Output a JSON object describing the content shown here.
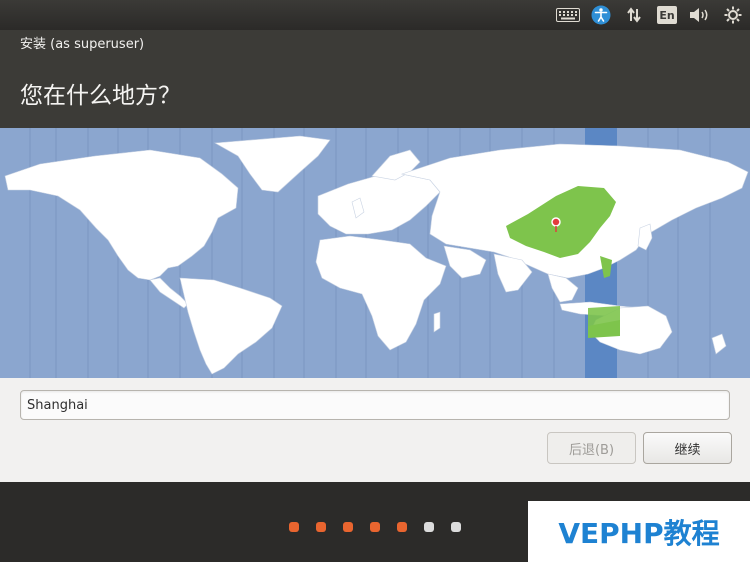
{
  "panel": {
    "language_badge": "En"
  },
  "window": {
    "title": "安装 (as superuser)",
    "heading": "您在什么地方？"
  },
  "location": {
    "value": "Shanghai"
  },
  "buttons": {
    "back_label": "后退(B)",
    "continue_label": "继续"
  },
  "progress": {
    "total_steps": 7,
    "completed_steps": 5,
    "active_color": "#e9652f",
    "inactive_color": "#dcdcdc"
  },
  "watermark": {
    "text": "VEPHP教程"
  },
  "colors": {
    "ocean": "#8ba6cf",
    "land": "#ffffff",
    "selected_zone": "#7ec44c",
    "timezone_band": "#5b87c4",
    "pin": "#e23d3d"
  }
}
